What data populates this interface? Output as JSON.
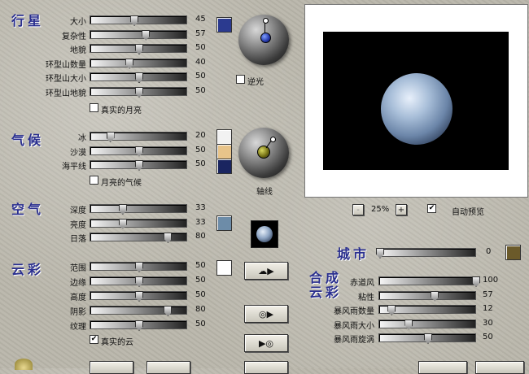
{
  "sections": {
    "planet": "行星",
    "climate": "气候",
    "atmosphere": "空气",
    "clouds": "云彩",
    "city": "城市",
    "synth_clouds": "合成\n云彩"
  },
  "planet_sliders": [
    {
      "label": "大小",
      "value": "45",
      "level": 0.45
    },
    {
      "label": "复杂性",
      "value": "57",
      "level": 0.57
    },
    {
      "label": "地貌",
      "value": "50",
      "level": 0.5
    },
    {
      "label": "环型山数量",
      "value": "40",
      "level": 0.4
    },
    {
      "label": "环型山大小",
      "value": "50",
      "level": 0.5
    },
    {
      "label": "环型山地貌",
      "value": "50",
      "level": 0.5
    }
  ],
  "planet_checkbox": {
    "label": "真实的月亮",
    "checked": false
  },
  "backlight_checkbox": {
    "label": "逆光",
    "checked": false,
    "mark": ""
  },
  "climate_sliders": [
    {
      "label": "冰",
      "value": "20",
      "level": 0.2
    },
    {
      "label": "沙漠",
      "value": "50",
      "level": 0.5
    },
    {
      "label": "海平线",
      "value": "50",
      "level": 0.5
    }
  ],
  "climate_checkbox": {
    "label": "月亮的气候",
    "checked": false
  },
  "axis_label": "轴线",
  "atmosphere_sliders": [
    {
      "label": "深度",
      "value": "33",
      "level": 0.33
    },
    {
      "label": "亮度",
      "value": "33",
      "level": 0.33
    },
    {
      "label": "日落",
      "value": "80",
      "level": 0.8
    }
  ],
  "cloud_sliders": [
    {
      "label": "范围",
      "value": "50",
      "level": 0.5
    },
    {
      "label": "边缘",
      "value": "50",
      "level": 0.5
    },
    {
      "label": "高度",
      "value": "50",
      "level": 0.5
    },
    {
      "label": "阴影",
      "value": "80",
      "level": 0.8
    },
    {
      "label": "纹理",
      "value": "50",
      "level": 0.5
    }
  ],
  "cloud_checkbox": {
    "label": "真实的云",
    "checked": true,
    "mark": "✔"
  },
  "zoom": {
    "minus": "-",
    "value": "25%",
    "plus": "+"
  },
  "auto_preview": {
    "label": "自动预览",
    "checked": true,
    "mark": "✔"
  },
  "city_slider": {
    "value": "0",
    "level": 0.0
  },
  "synth_sliders": [
    {
      "label": "赤道风",
      "value": "100",
      "level": 1.0
    },
    {
      "label": "粘性",
      "value": "57",
      "level": 0.57
    },
    {
      "label": "暴风雨数量",
      "value": "12",
      "level": 0.12
    },
    {
      "label": "暴风雨大小",
      "value": "30",
      "level": 0.3
    },
    {
      "label": "暴风雨旋涡",
      "value": "50",
      "level": 0.5
    }
  ],
  "colors": {
    "planet_swatch": "#2b3a8f",
    "ice_swatch": "#f2f2f2",
    "desert_swatch": "#e8c48a",
    "sea_swatch": "#1a2560",
    "atmo_swatch": "#6d8ca8",
    "cloud_swatch": "#ffffff",
    "city_swatch": "#6b5a2a"
  },
  "icons": {
    "cloud_button": "cloud-arrow-icon",
    "play1": "disc-arrow-icon",
    "play2": "arrow-disc-icon"
  }
}
